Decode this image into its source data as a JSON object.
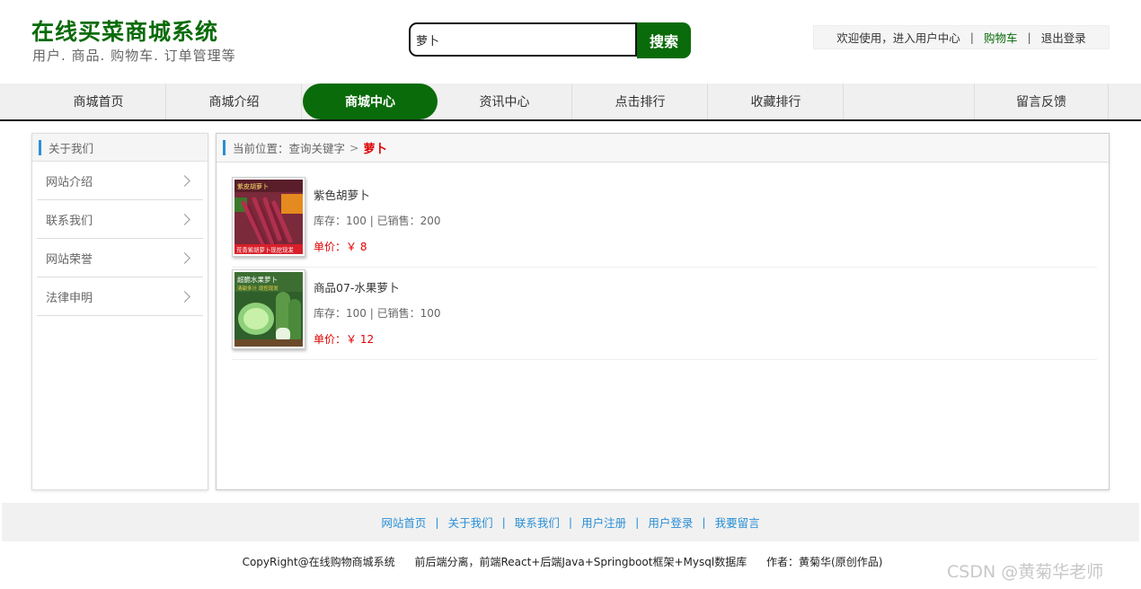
{
  "header": {
    "title": "在线买菜商城系统",
    "subtitle": "用户. 商品. 购物车. 订单管理等",
    "search_value": "萝卜",
    "search_button": "搜索",
    "welcome": "欢迎使用，进入用户中心",
    "cart": "购物车",
    "logout": "退出登录"
  },
  "nav": {
    "items": [
      "商城首页",
      "商城介绍",
      "商城中心",
      "资讯中心",
      "点击排行",
      "收藏排行",
      "留言反馈"
    ],
    "active": "商城中心"
  },
  "sidebar": {
    "heading": "关于我们",
    "items": [
      "网站介绍",
      "联系我们",
      "网站荣誉",
      "法律申明"
    ]
  },
  "breadcrumb": {
    "prefix": "当前位置：",
    "path": "查询关键字",
    "separator": ">",
    "keyword": "萝卜"
  },
  "products": [
    {
      "name": "紫色胡萝卜",
      "stock": "库存：100 | 已销售：200",
      "price": "单价：￥ 8",
      "image_caption_top": "紫皮胡萝卜",
      "image_caption_bottom": "荒青紫胡萝卜现挖现发"
    },
    {
      "name": "商品07-水果萝卜",
      "stock": "库存：100 | 已销售：100",
      "price": "单价：￥ 12",
      "image_caption_top": "超脆水果萝卜",
      "image_caption_bottom": "清甜多汁 现挖现发"
    }
  ],
  "footer": {
    "links": [
      "网站首页",
      "关于我们",
      "联系我们",
      "用户注册",
      "用户登录",
      "我要留言"
    ],
    "copyright": "CopyRight@在线购物商城系统",
    "stack": "前后端分离，前端React+后端Java+Springboot框架+Mysql数据库",
    "author": "作者：黄菊华(原创作品)",
    "watermark": "CSDN @黄菊华老师"
  },
  "colors": {
    "brand_green": "#0a6b0a",
    "link_blue": "#2a8fd6",
    "price_red": "#e00000"
  }
}
